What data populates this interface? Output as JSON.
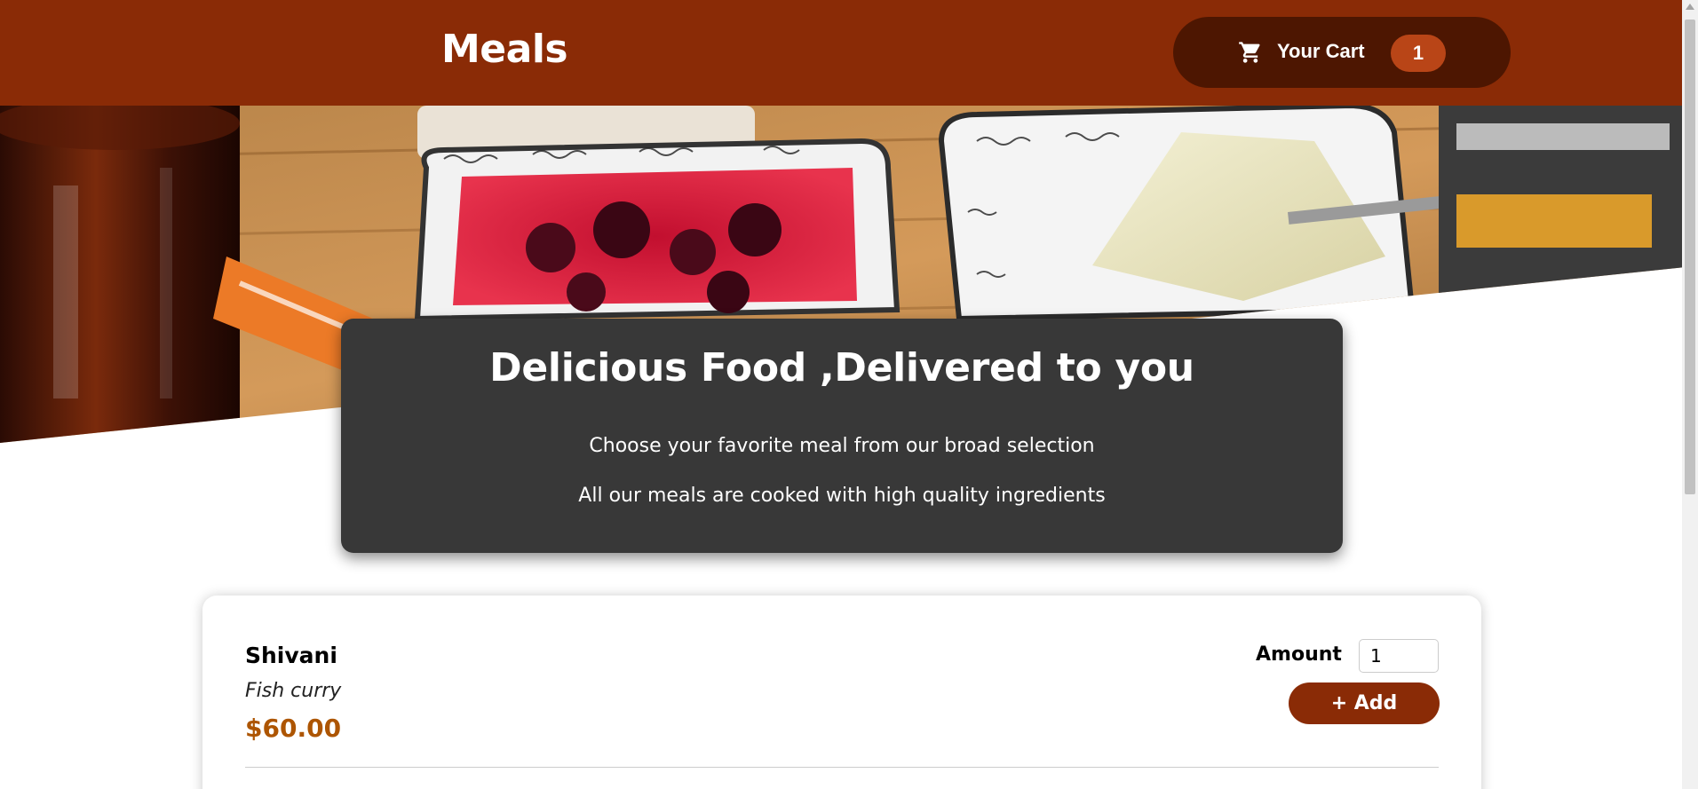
{
  "header": {
    "brand": "Meals",
    "cart": {
      "label": "Your Cart",
      "count": "1",
      "icon": "cart-icon"
    }
  },
  "hero": {
    "image_alt": "A table full of delicious food"
  },
  "summary": {
    "title": "Delicious Food ,Delivered to you",
    "line1": "Choose your favorite meal from our broad selection",
    "line2": "All our meals are cooked with high quality ingredients"
  },
  "meals": [
    {
      "name": "Shivani",
      "description": "Fish curry",
      "price": "$60.00",
      "amount_label": "Amount",
      "amount_value": "1",
      "add_label": "+ Add"
    }
  ],
  "colors": {
    "header_bg": "#8a2b06",
    "cart_bg": "#4d1601",
    "badge_bg": "#b94517",
    "summary_bg": "#383838",
    "price": "#ad5502"
  }
}
